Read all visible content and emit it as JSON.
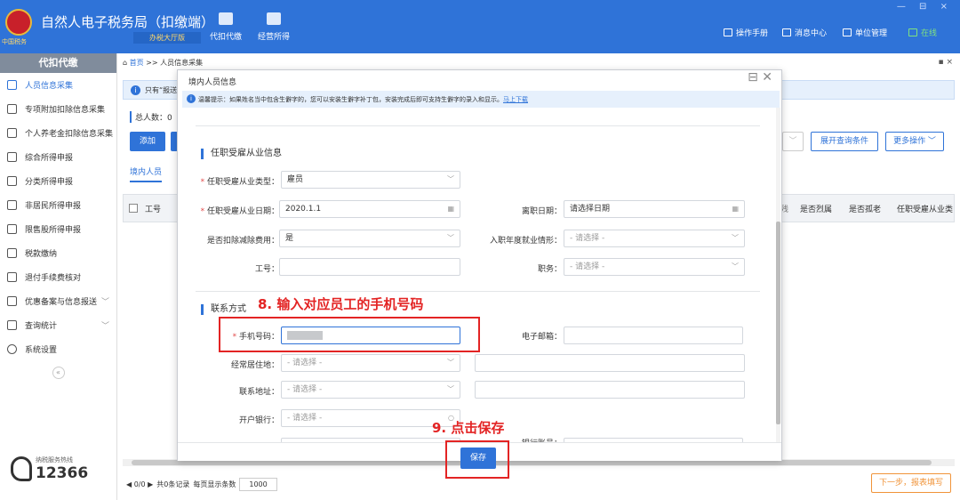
{
  "header": {
    "emblem_label": "中国税务",
    "title": "自然人电子税务局（扣缴端）",
    "hall_badge": "办税大厅版",
    "nav": [
      {
        "label": "代扣代缴"
      },
      {
        "label": "经营所得"
      }
    ],
    "right": [
      {
        "label": "操作手册"
      },
      {
        "label": "消息中心"
      },
      {
        "label": "单位管理"
      }
    ],
    "online": "在线",
    "window_controls": "— ⊟ ×"
  },
  "sidebar": {
    "title": "代扣代缴",
    "items": [
      {
        "label": "人员信息采集",
        "active": true
      },
      {
        "label": "专项附加扣除信息采集"
      },
      {
        "label": "个人养老金扣除信息采集"
      },
      {
        "label": "综合所得申报"
      },
      {
        "label": "分类所得申报"
      },
      {
        "label": "非居民所得申报"
      },
      {
        "label": "限售股所得申报"
      },
      {
        "label": "税款缴纳"
      },
      {
        "label": "退付手续费核对"
      },
      {
        "label": "优惠备案与信息报送",
        "chevron": "﹀"
      },
      {
        "label": "查询统计",
        "chevron": "﹀"
      },
      {
        "label": "系统设置"
      }
    ],
    "collapse": "«",
    "hotline_label": "纳税服务热线",
    "hotline_number": "12366"
  },
  "main": {
    "breadcrumb": {
      "home": "首页",
      "sep": " >> ",
      "current": "人员信息采集"
    },
    "window_controls": "▪ ×",
    "info": "只有“报送",
    "info_icon": "i",
    "total": "总人数：0",
    "add_button": "添加",
    "expand_button": "展开查询条件",
    "more_button": "更多操作 ﹀",
    "dropdown_arrow": "﹀",
    "tab_inner": "境内人员",
    "table_headers": [
      "工号",
      "是否烈属",
      "是否孤老",
      "任职受雇从业类"
    ],
    "table_header_partial": "残",
    "pager": {
      "nav": "◀ 0/0 ▶",
      "total_records": "共0条记录",
      "page_size_label": "每页显示条数",
      "page_size": "1000"
    },
    "next_button": "下一步，报表填写"
  },
  "dialog": {
    "title": "境内人员信息",
    "controls": "⊟ ✕",
    "tip_icon": "i",
    "tip": "温馨提示：如果姓名当中包含生僻字的，您可以安装生僻字补丁包，安装完成后即可支持生僻字的录入和显示。",
    "tip_link": "马上下载",
    "section1": "任职受雇从业信息",
    "section2": "联系方式",
    "fields": {
      "emp_type_label": "任职受雇从业类型：",
      "emp_type_value": "雇员",
      "emp_date_label": "任职受雇从业日期：",
      "emp_date_value": "2020.1.1",
      "leave_date_label": "离职日期：",
      "leave_date_placeholder": "请选择日期",
      "deduct_label": "是否扣除减除费用：",
      "deduct_value": "是",
      "entry_year_label": "入职年度就业情形：",
      "entry_year_placeholder": "- 请选择 -",
      "staff_no_label": "工号：",
      "position_label": "职务：",
      "position_placeholder": "- 请选择 -",
      "phone_label": "手机号码：",
      "email_label": "电子邮箱：",
      "residence_label": "经常居住地：",
      "residence_placeholder": "- 请选择 -",
      "address_label": "联系地址：",
      "address_placeholder": "- 请选择 -",
      "bank_label": "开户银行：",
      "bank_placeholder": "- 请选择 -",
      "bank_account_label": "银行账号："
    },
    "save_button": "保存"
  },
  "annotations": {
    "step8": "8. 输入对应员工的手机号码",
    "step9": "9. 点击保存"
  },
  "colors": {
    "header": "#2f73d8",
    "annotation": "#e32424",
    "next_button": "#f0943a"
  },
  "icons": [
    "home-icon",
    "info-icon",
    "calendar-icon",
    "search-icon",
    "phone-icon"
  ]
}
